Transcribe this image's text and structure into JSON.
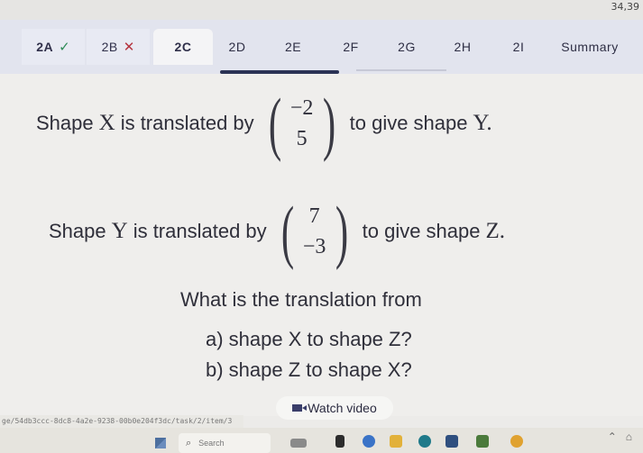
{
  "coords": "34,39",
  "tabs": [
    {
      "label": "2A",
      "mark": "✓",
      "state": "correct"
    },
    {
      "label": "2B",
      "mark": "✕",
      "state": "incorrect"
    },
    {
      "label": "2C",
      "mark": "",
      "state": "active"
    },
    {
      "label": "2D",
      "mark": "",
      "state": "pending"
    },
    {
      "label": "2E",
      "mark": "",
      "state": "pending"
    },
    {
      "label": "2F",
      "mark": "",
      "state": "pending"
    },
    {
      "label": "2G",
      "mark": "",
      "state": "pending"
    },
    {
      "label": "2H",
      "mark": "",
      "state": "pending"
    },
    {
      "label": "2I",
      "mark": "",
      "state": "pending"
    },
    {
      "label": "Summary",
      "mark": "",
      "state": "pending"
    }
  ],
  "question": {
    "line1": {
      "before": "Shape",
      "shape_a": "X",
      "mid": "is translated by",
      "vector": [
        "−2",
        "5"
      ],
      "after": "to give shape",
      "shape_b": "Y."
    },
    "line2": {
      "before": "Shape",
      "shape_a": "Y",
      "mid": "is translated by",
      "vector": [
        "7",
        "−3"
      ],
      "after": "to give shape",
      "shape_b": "Z."
    },
    "prompt": "What is the translation from",
    "part_a": "a) shape X to shape Z?",
    "part_b": "b) shape Z to shape X?"
  },
  "watch_video_label": "Watch video",
  "url_text": "ge/54db3ccc-8dc8-4a2e-9238-00b0e204f3dc/task/2/item/3",
  "taskbar": {
    "search_placeholder": "Search"
  },
  "colors": {
    "correct": "#2e8b57",
    "incorrect": "#b5343f",
    "accent": "#2b3355"
  }
}
